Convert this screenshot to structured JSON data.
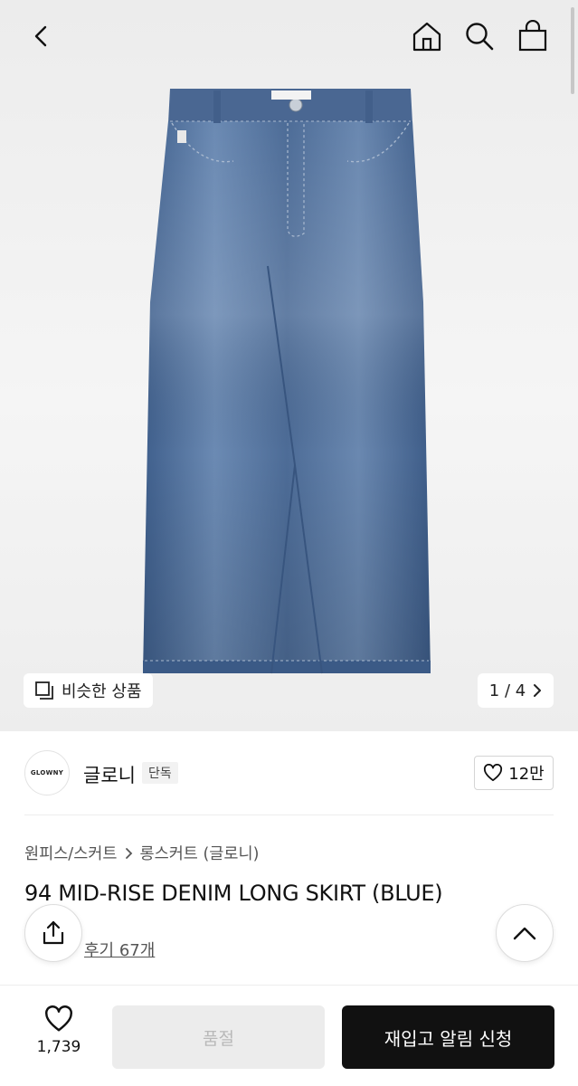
{
  "hero": {
    "similar_label": "비슷한 상품",
    "page_indicator": "1 / 4"
  },
  "brand": {
    "logo_text": "GLOWNY",
    "name": "글로니",
    "badge": "단독",
    "likes": "12만"
  },
  "product": {
    "breadcrumb": [
      "원피스/스커트",
      "롱스커트 (글로니)"
    ],
    "title": "94 MID-RISE DENIM LONG SKIRT (BLUE)",
    "reviews_label": "후기 67개"
  },
  "bottom_bar": {
    "wish_count": "1,739",
    "soldout_label": "품절",
    "restock_label": "재입고 알림 신청"
  },
  "icons": [
    "back-icon",
    "home-icon",
    "search-icon",
    "bag-icon",
    "similar-icon",
    "chevron-right-icon",
    "heart-icon",
    "share-icon",
    "chevron-up-icon",
    "star-icon"
  ],
  "colors": {
    "accent": "#111111",
    "disabled_bg": "#ececec",
    "disabled_text": "#b9b9b9",
    "star": "#f5a623"
  }
}
